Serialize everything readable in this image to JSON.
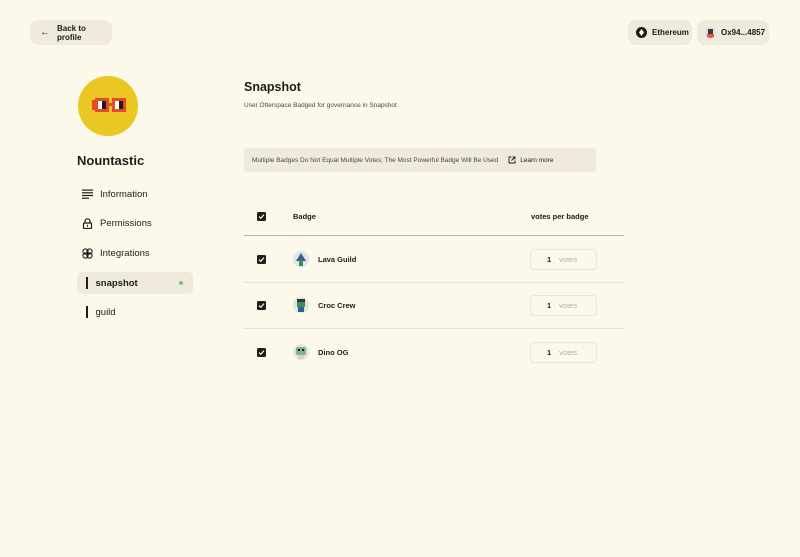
{
  "header": {
    "back_label": "Back to profile",
    "network_label": "Ethereum",
    "wallet_label": "Ox94...4857"
  },
  "profile": {
    "name": "Nountastic",
    "avatar_icon": "noggles-avatar",
    "avatar_color": "#ebc724"
  },
  "sidebar": {
    "items": [
      {
        "label": "Information",
        "icon": "list-icon"
      },
      {
        "label": "Permissions",
        "icon": "lock-icon"
      },
      {
        "label": "Integrations",
        "icon": "integrations-icon"
      },
      {
        "label": "snapshot",
        "active": true
      },
      {
        "label": "guild"
      }
    ]
  },
  "main": {
    "title": "Snapshot",
    "subtitle": "User Otterspace Badged for governance in Snapshot",
    "notice": "Multiple Badges Do Not Equal Multiple Votes; The Most Powerful Badge Will Be Used",
    "learn_more": "Learn more"
  },
  "table": {
    "col_badge": "Badge",
    "col_votes": "votes per badge",
    "rows": [
      {
        "name": "Lava Guild",
        "votes": "1",
        "unit": "votes",
        "checked": true
      },
      {
        "name": "Croc Crew",
        "votes": "1",
        "unit": "votes",
        "checked": true
      },
      {
        "name": "Dino OG",
        "votes": "1",
        "unit": "votes",
        "checked": true
      }
    ]
  }
}
